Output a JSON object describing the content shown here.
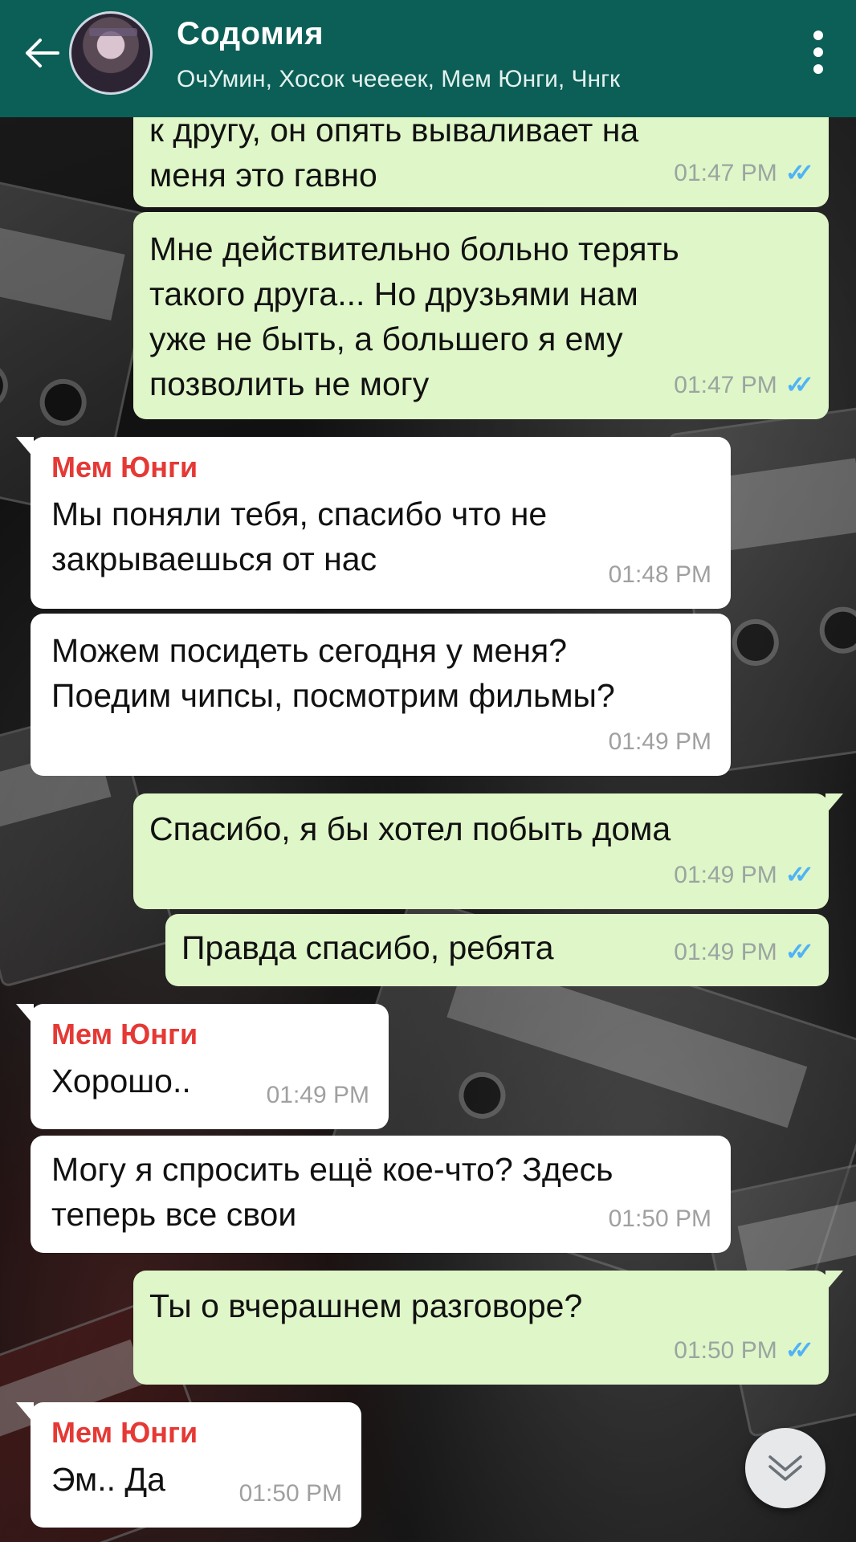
{
  "header": {
    "title": "Содомия",
    "subtitle": "ОчУмин, Хосок чеееек, Мем Юнги, Чнгк"
  },
  "messages": [
    {
      "direction": "out",
      "text": "к другу, он опять вываливает на\nменя это гавно",
      "time": "01:47 PM",
      "status": "read"
    },
    {
      "direction": "out",
      "text": "Мне действительно больно терять\nтакого друга... Но друзьями нам\nуже не быть, а большего я ему\nпозволить не могу",
      "time": "01:47 PM",
      "status": "read"
    },
    {
      "direction": "in",
      "sender": "Мем Юнги",
      "text": "Мы поняли тебя, спасибо что не\nзакрываешься от нас",
      "time": "01:48 PM"
    },
    {
      "direction": "in",
      "text": "Можем посидеть сегодня у меня?\nПоедим чипсы, посмотрим фильмы?",
      "time": "01:49 PM"
    },
    {
      "direction": "out",
      "text": "Спасибо, я бы хотел побыть дома",
      "time": "01:49 PM",
      "status": "read"
    },
    {
      "direction": "out",
      "text": "Правда спасибо, ребята",
      "time": "01:49 PM",
      "status": "read"
    },
    {
      "direction": "in",
      "sender": "Мем Юнги",
      "text": "Хорошо..",
      "time": "01:49 PM"
    },
    {
      "direction": "in",
      "text": "Могу я спросить ещё кое-что? Здесь\nтеперь все свои",
      "time": "01:50 PM"
    },
    {
      "direction": "out",
      "text": "Ты о вчерашнем разговоре?",
      "time": "01:50 PM",
      "status": "read"
    },
    {
      "direction": "in",
      "sender": "Мем Юнги",
      "text": "Эм.. Да",
      "time": "01:50 PM"
    }
  ],
  "colors": {
    "header_bg": "#0b5f56",
    "outgoing_bubble": "#dff6c8",
    "incoming_bubble": "#ffffff",
    "sender_name": "#e53935",
    "read_ticks": "#4fb3f6"
  },
  "icons": {
    "back": "arrow-left-icon",
    "menu": "more-vert-icon",
    "scroll": "double-chevron-down-icon",
    "read": "double-check-icon"
  }
}
